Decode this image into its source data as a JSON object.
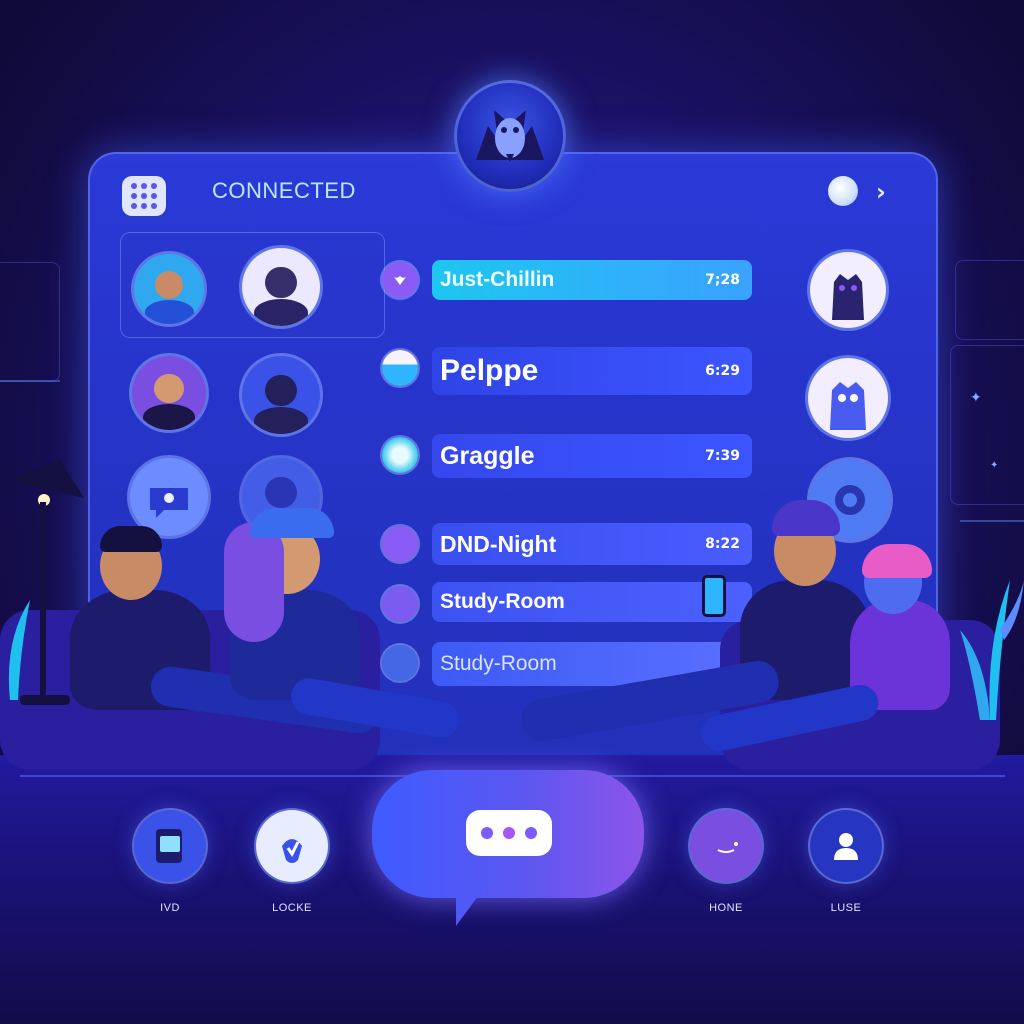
{
  "header": {
    "status": "CONNECTED"
  },
  "channels": [
    {
      "name": "Just-Chillin",
      "time": "7;28",
      "style": "active"
    },
    {
      "name": "Pelppe",
      "time": "6:29",
      "style": "normal"
    },
    {
      "name": "Graggle",
      "time": "7:39",
      "style": "normal"
    },
    {
      "name": "DND-Night",
      "time": "8:22",
      "style": "normal"
    },
    {
      "name": "Study-Room",
      "time": "",
      "style": "normal"
    },
    {
      "name": "Study-Room",
      "time": "",
      "style": "muted"
    }
  ],
  "bottom_nav": {
    "items": [
      {
        "label": "IVD",
        "icon": "card-icon"
      },
      {
        "label": "LOCKE",
        "icon": "lock-icon"
      },
      {
        "label": "HONE",
        "icon": "smiley-icon"
      },
      {
        "label": "LUSE",
        "icon": "user-icon"
      }
    ]
  },
  "colors": {
    "accent": "#2b3ad8",
    "active_channel": "#1fb8f0",
    "bubble": "#5b57f0",
    "typing_dots": [
      "#7c5cff",
      "#a855f7",
      "#7c5cff"
    ]
  }
}
